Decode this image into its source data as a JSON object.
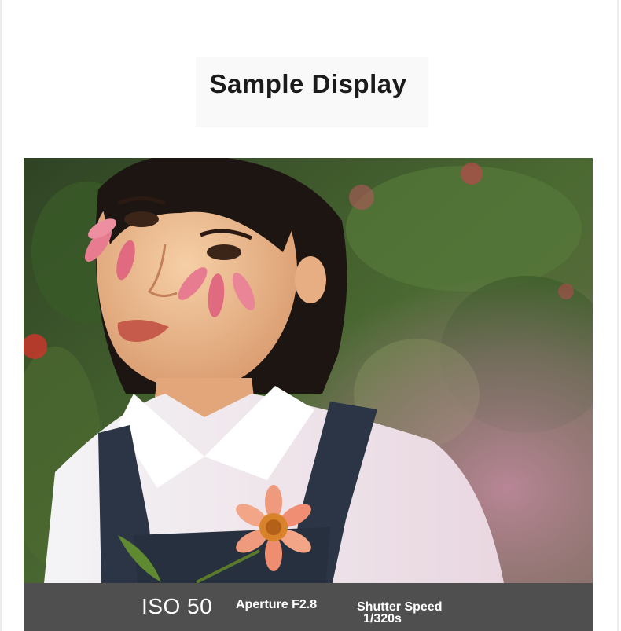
{
  "header": {
    "title": "Sample Display"
  },
  "photo": {
    "subject": "portrait"
  },
  "exif_bar": {
    "iso": "ISO 50",
    "aperture": "Aperture F2.8",
    "shutter_label": "Shutter Speed",
    "shutter_value": "1/320s"
  },
  "colors": {
    "background": "#ffffff",
    "title_text": "#1b1b1b",
    "info_bar": "#4f4f4f",
    "info_text": "#ffffff"
  }
}
